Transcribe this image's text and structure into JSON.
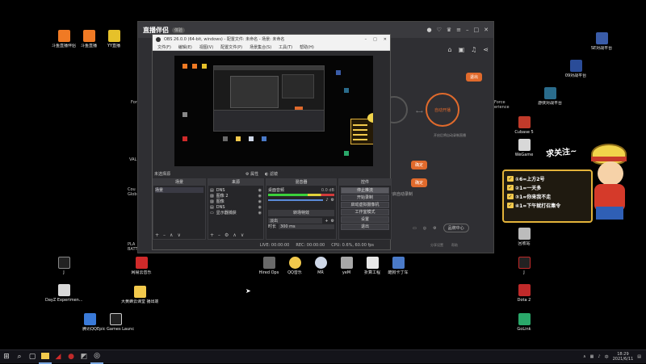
{
  "desktop": {
    "icons_left": [
      {
        "label": "斗鱼直播伴侣",
        "color": "#f07a24"
      },
      {
        "label": "斗鱼直播",
        "color": "#f07a24"
      },
      {
        "label": "YY直播",
        "color": "#e6c12a"
      }
    ],
    "icons_right": [
      {
        "label": "SE对战平台",
        "color": "#3a5ca8"
      },
      {
        "label": "09对战平台",
        "color": "#2a4c98"
      },
      {
        "label": "游侠对战平台",
        "color": "#2a6c8c"
      },
      {
        "label": "Cubase 5",
        "color": "#c03a2a"
      },
      {
        "label": "WeGame",
        "color": "#d8d8d8"
      },
      {
        "label": "回收站",
        "color": "#bcbcbc"
      },
      {
        "label": "Dota 2",
        "color": "#c02a2a"
      },
      {
        "label": "GoLink",
        "color": "#2aa86a"
      }
    ],
    "icons_bottom": [
      {
        "label": "网易云音乐",
        "color": "#d02a2a"
      },
      {
        "label": "Hired Ops",
        "color": "#6a6a6a"
      },
      {
        "label": "QQ音乐",
        "color": "#f2c94c"
      },
      {
        "label": "MR",
        "color": "#cfd8e8"
      },
      {
        "label": "yeM",
        "color": "#a8a8a8"
      },
      {
        "label": "折算工程",
        "color": "#e8e8e8"
      },
      {
        "label": "酷狗卡丁车",
        "color": "#4a7ac8"
      }
    ],
    "icons_left_lower": [
      {
        "label": "J",
        "color": "#222"
      },
      {
        "label": "DayZ Experimen...",
        "color": "#d8d8d8"
      },
      {
        "label": "大黄蜂云课堂 播出端",
        "color": "#f2c94c"
      },
      {
        "label": "腾讯QQ",
        "color": "#3a7ad8"
      },
      {
        "label": "Epic Games Launcher",
        "color": "#222"
      }
    ],
    "partial_labels": [
      "工具",
      "VAL",
      "Cou Glob",
      "PLA BATT",
      "Anc",
      "Force erience"
    ]
  },
  "app_window": {
    "logo": "直播伴侣",
    "badge": "体验",
    "exit_button": "退出",
    "auto_broadcast": "自动开播",
    "auto_record_label": "开启自动录制",
    "auto_record_hint": "开启后将自动录制直播",
    "small_btn": "确定",
    "footer_pill": "品牌中心",
    "footer_items": [
      "分享设置",
      "帮助"
    ]
  },
  "obs": {
    "title": "OBS 26.0.0 (64-bit, windows) - 配置文件: 未命名 - 场景: 未命名",
    "menu": [
      "文件(F)",
      "编辑(E)",
      "视图(V)",
      "配置文件(P)",
      "场景集合(S)",
      "工具(T)",
      "帮助(H)"
    ],
    "no_source": "未选择源",
    "props": "属性",
    "filters": "滤镜",
    "scenes_header": "场景",
    "scene_item": "场景",
    "sources_header": "来源",
    "sources": [
      "DNS",
      "图像 2",
      "图像",
      "DNS",
      "显示器捕获"
    ],
    "mixer_header": "混音器",
    "mixer_item": "桌面音频",
    "mixer_db": "0.0 dB",
    "transitions_header": "转场特效",
    "transition_value": "淡出",
    "duration_label": "时长",
    "duration_value": "300 ms",
    "controls_header": "控件",
    "controls": [
      "停止推流",
      "开始录制",
      "启动虚拟摄像机",
      "工作室模式",
      "设置",
      "退出"
    ],
    "status": [
      "LIVE: 00:00:00",
      "REC: 00:00:00",
      "CPU: 0.6%, 60.00 fps"
    ]
  },
  "sticker": {
    "title": "求关注~",
    "lines": [
      "①6=上方2号",
      "②1=一天多",
      "③1=你来我不走",
      "④1=下午就打召集令"
    ]
  },
  "taskbar": {
    "start_icon": "windows-icon",
    "time": "18:29",
    "date": "2021/6/11",
    "tray_text": "中"
  }
}
